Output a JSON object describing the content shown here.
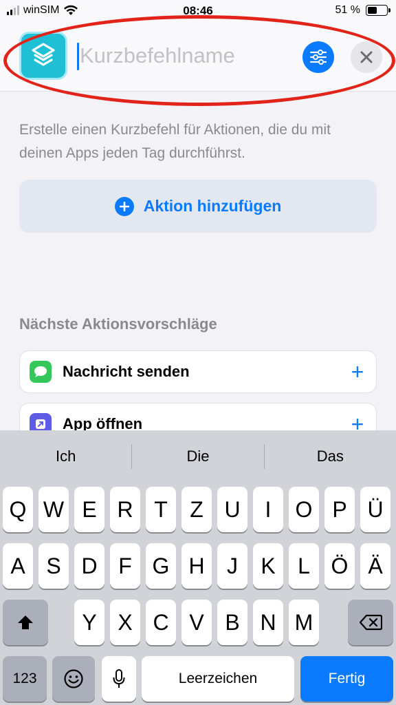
{
  "status_bar": {
    "carrier": "winSIM",
    "time": "08:46",
    "battery_percent": "51 %",
    "battery_level": 0.51
  },
  "header": {
    "app_icon": "shortcuts-layers-icon",
    "name_placeholder": "Kurzbefehlname",
    "settings_icon": "sliders-icon",
    "close_icon": "close-icon",
    "annotation_color": "#e2231a"
  },
  "content": {
    "intro_text": "Erstelle einen Kurzbefehl für Aktionen, die du mit deinen Apps jeden Tag durchführst.",
    "add_action_label": "Aktion hinzufügen",
    "section_title": "Nächste Aktionsvorschläge",
    "suggestions": [
      {
        "label": "Nachricht senden",
        "icon": "messages-icon",
        "color": "#34c759"
      },
      {
        "label": "App öffnen",
        "icon": "open-app-icon",
        "color": "#5e5ce6"
      }
    ]
  },
  "keyboard": {
    "predictions": [
      "Ich",
      "Die",
      "Das"
    ],
    "row1": [
      "Q",
      "W",
      "E",
      "R",
      "T",
      "Z",
      "U",
      "I",
      "O",
      "P",
      "Ü"
    ],
    "row2": [
      "A",
      "S",
      "D",
      "F",
      "G",
      "H",
      "J",
      "K",
      "L",
      "Ö",
      "Ä"
    ],
    "row3": [
      "Y",
      "X",
      "C",
      "V",
      "B",
      "N",
      "M"
    ],
    "numbers_label": "123",
    "space_label": "Leerzeichen",
    "done_label": "Fertig",
    "accent_color": "#0a7afe"
  }
}
